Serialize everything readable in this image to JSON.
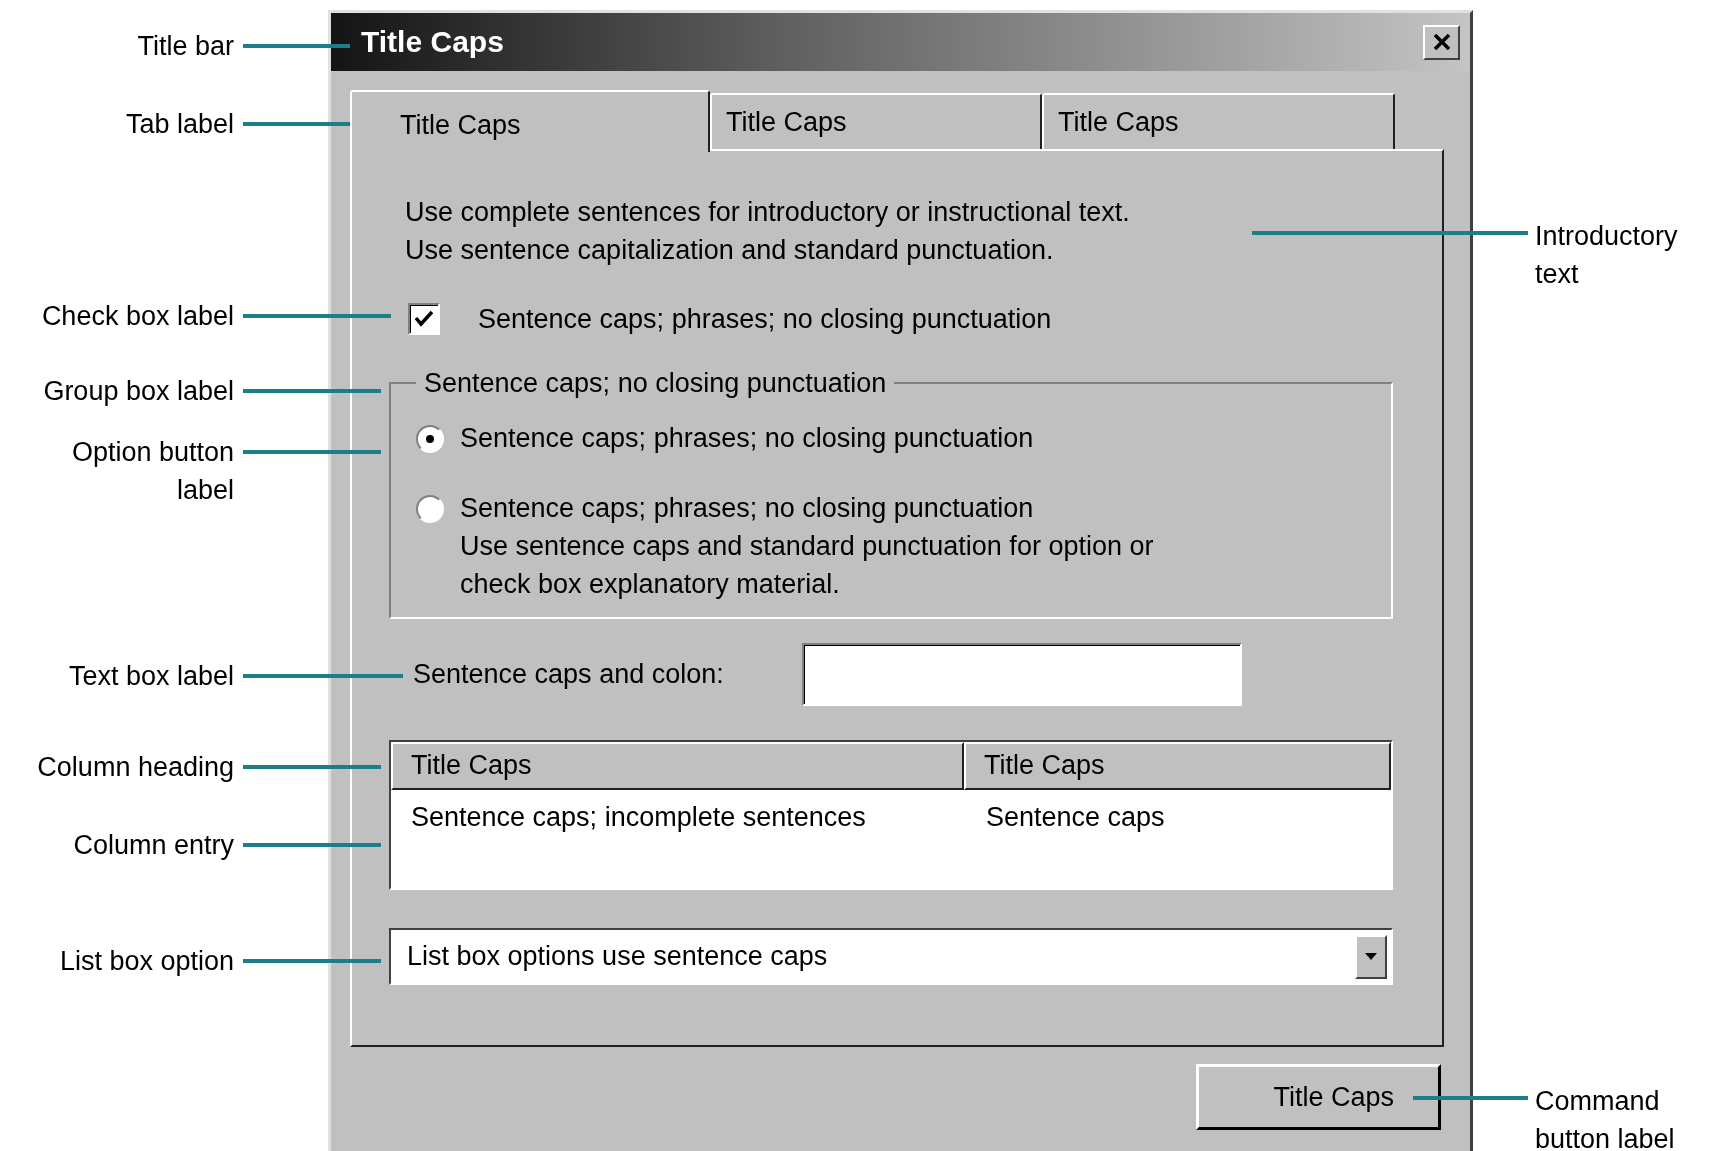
{
  "window": {
    "title": "Title Caps"
  },
  "tabs": [
    {
      "label": "Title Caps",
      "selected": true
    },
    {
      "label": "Title Caps",
      "selected": false
    },
    {
      "label": "Title Caps",
      "selected": false
    }
  ],
  "intro_text": "Use complete sentences for introductory or instructional text.\nUse sentence capitalization and standard punctuation.",
  "checkbox": {
    "label": "Sentence caps; phrases; no closing punctuation",
    "checked": true
  },
  "group": {
    "label": "Sentence caps; no closing punctuation",
    "options": [
      {
        "label": "Sentence caps; phrases; no closing punctuation",
        "selected": true
      },
      {
        "label": "Sentence caps; phrases; no closing punctuation",
        "description": "Use sentence caps and standard punctuation for option or\ncheck box explanatory material.",
        "selected": false
      }
    ]
  },
  "text_field": {
    "label": "Sentence caps and colon:"
  },
  "table": {
    "columns": [
      "Title Caps",
      "Title Caps"
    ],
    "rows": [
      [
        "Sentence caps; incomplete sentences",
        "Sentence caps"
      ]
    ]
  },
  "list_box": {
    "value": "List box options use sentence caps"
  },
  "command_button": {
    "label": "Title Caps"
  },
  "left_callouts": [
    {
      "label": "Title bar"
    },
    {
      "label": "Tab label"
    },
    {
      "label": "Check box label"
    },
    {
      "label": "Group box label"
    },
    {
      "label": "Option button\nlabel"
    },
    {
      "label": "Text box label"
    },
    {
      "label": "Column heading"
    },
    {
      "label": "Column entry"
    },
    {
      "label": "List box option"
    }
  ],
  "right_callouts": [
    {
      "label": "Introductory\ntext"
    },
    {
      "label": "Command\nbutton label"
    }
  ]
}
